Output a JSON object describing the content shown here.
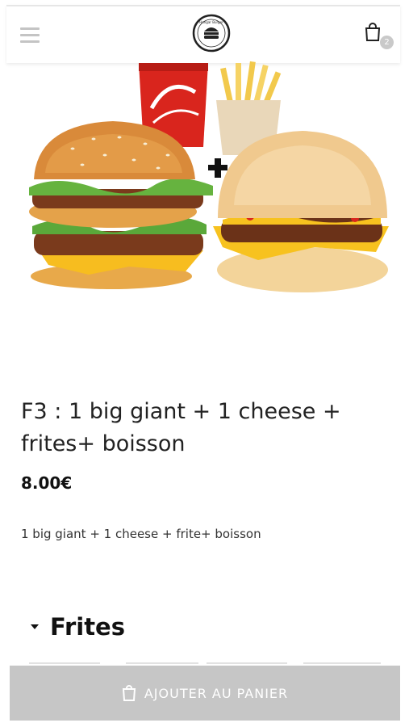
{
  "header": {
    "menu_icon": "hamburger-menu-icon",
    "logo": {
      "name": "restaurant-logo",
      "alt": "Hangar Burger"
    },
    "cart": {
      "icon": "shopping-bag-icon",
      "count": "2"
    }
  },
  "product": {
    "image_alt": "F3 menu: big giant burger, cheeseburger, fries and cola",
    "title": "F3 : 1 big giant + 1 cheese + frites+ boisson",
    "price": "8.00€",
    "description": "1 big giant + 1 cheese + frite+ boisson"
  },
  "options": {
    "section_title": "Frites",
    "toggle_icon": "caret-down-icon"
  },
  "footer": {
    "add_to_cart_label": "AJOUTER AU PANIER",
    "add_to_cart_icon": "shopping-bag-icon"
  },
  "colors": {
    "button_bg": "#c6c6c6",
    "cola_red": "#d9251d",
    "cheese_yellow": "#f7bd1f"
  }
}
